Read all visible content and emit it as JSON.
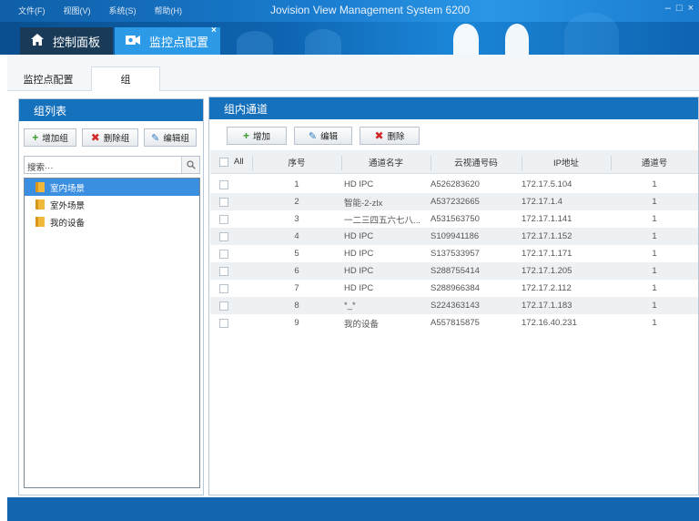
{
  "menu": [
    "文件(F)",
    "视图(V)",
    "系统(S)",
    "帮助(H)"
  ],
  "app_title": "Jovision View Management System 6200",
  "window_controls": [
    "–",
    "□",
    "×"
  ],
  "top_tabs": [
    {
      "label": "控制面板",
      "icon": "home-icon"
    },
    {
      "label": "监控点配置",
      "icon": "camera-icon"
    }
  ],
  "top_tab_close": "×",
  "sub_tabs": [
    "监控点配置",
    "组"
  ],
  "left_panel": {
    "title": "组列表",
    "buttons": [
      {
        "label": "增加组",
        "icon": "plus-icon"
      },
      {
        "label": "删除组",
        "icon": "delete-icon"
      },
      {
        "label": "编辑组",
        "icon": "pencil-icon"
      }
    ],
    "search_placeholder": "搜索···",
    "tree": [
      {
        "label": "室内场景",
        "selected": true
      },
      {
        "label": "室外场景",
        "selected": false
      },
      {
        "label": "我的设备",
        "selected": false
      }
    ]
  },
  "right_panel": {
    "title": "组内通道",
    "buttons": [
      {
        "label": "增加",
        "icon": "plus-icon"
      },
      {
        "label": "编辑",
        "icon": "pencil-icon"
      },
      {
        "label": "删除",
        "icon": "delete-icon"
      }
    ],
    "columns": [
      "All",
      "序号",
      "通道名字",
      "云视通号码",
      "IP地址",
      "通道号"
    ],
    "rows": [
      {
        "no": "1",
        "name": "HD IPC",
        "cloud": "A526283620",
        "ip": "172.17.5.104",
        "ch": "1"
      },
      {
        "no": "2",
        "name": "智能-2-zlx",
        "cloud": "A537232665",
        "ip": "172.17.1.4",
        "ch": "1"
      },
      {
        "no": "3",
        "name": "一二三四五六七八...",
        "cloud": "A531563750",
        "ip": "172.17.1.141",
        "ch": "1"
      },
      {
        "no": "4",
        "name": "HD IPC",
        "cloud": "S109941186",
        "ip": "172.17.1.152",
        "ch": "1"
      },
      {
        "no": "5",
        "name": "HD IPC",
        "cloud": "S137533957",
        "ip": "172.17.1.171",
        "ch": "1"
      },
      {
        "no": "6",
        "name": "HD IPC",
        "cloud": "S288755414",
        "ip": "172.17.1.205",
        "ch": "1"
      },
      {
        "no": "7",
        "name": "HD IPC",
        "cloud": "S288966384",
        "ip": "172.17.2.112",
        "ch": "1"
      },
      {
        "no": "8",
        "name": "*_*",
        "cloud": "S224363143",
        "ip": "172.17.1.183",
        "ch": "1"
      },
      {
        "no": "9",
        "name": "我的设备",
        "cloud": "A557815875",
        "ip": "172.16.40.231",
        "ch": "1"
      }
    ]
  },
  "colors": {
    "accent": "#1671bd",
    "selected": "#3b8fe0",
    "titlebar": "#1a7ccf"
  }
}
